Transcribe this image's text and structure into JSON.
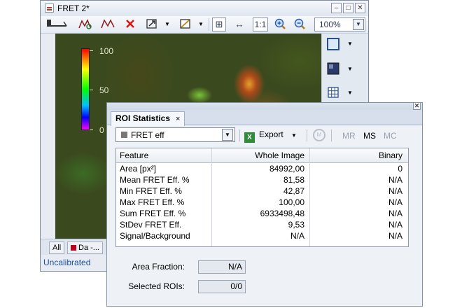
{
  "image_window": {
    "title": "FRET 2*",
    "zoom": "100%",
    "zoom_reset_label": "1:1",
    "colorbar_labels": [
      "100",
      "50",
      "0"
    ],
    "tabs": [
      {
        "label": "All"
      },
      {
        "label": "Da -..."
      }
    ],
    "status": "Uncalibrated"
  },
  "roi_window": {
    "tab_label": "ROI Statistics",
    "tab_close": "×",
    "series_select": "FRET eff",
    "export_label": "Export",
    "mask_buttons": [
      "MR",
      "MS",
      "MC"
    ],
    "table": {
      "headers": [
        "Feature",
        "Whole Image",
        "Binary"
      ],
      "rows": [
        [
          "Area [px²]",
          "84992,00",
          "0"
        ],
        [
          "Mean FRET Eff. %",
          "81,58",
          "N/A"
        ],
        [
          "Min FRET Eff. %",
          "42,87",
          "N/A"
        ],
        [
          "Max FRET Eff. %",
          "100,00",
          "N/A"
        ],
        [
          "Sum FRET Eff. %",
          "6933498,48",
          "N/A"
        ],
        [
          "StDev FRET Eff.",
          "9,53",
          "N/A"
        ],
        [
          "Signal/Background",
          "N/A",
          "N/A"
        ]
      ]
    },
    "area_fraction_label": "Area Fraction:",
    "area_fraction_value": "N/A",
    "selected_rois_label": "Selected ROIs:",
    "selected_rois_value": "0/0"
  },
  "colors": {
    "accent": "#1a4fa0",
    "window_bg": "#eef2f7",
    "legend_swatch": "#c0001a"
  }
}
